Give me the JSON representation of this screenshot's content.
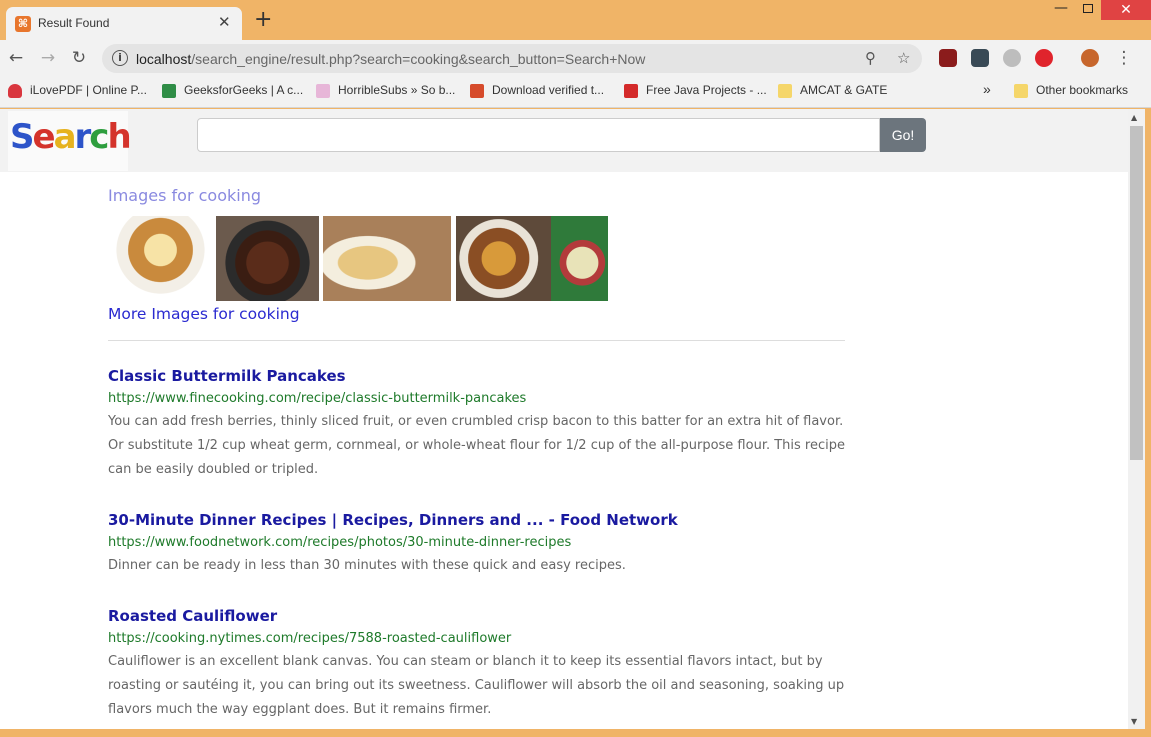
{
  "browser": {
    "tab_title": "Result Found",
    "favicon_glyph": "⌘",
    "close_glyph": "✕",
    "new_tab_glyph": "+",
    "url_host": "localhost",
    "url_path": "/search_engine/result.php?search=cooking&search_button=Search+Now",
    "bookmarks": [
      {
        "label": "iLovePDF | Online P...",
        "icon": "heart-icon",
        "color": "#d9363e"
      },
      {
        "label": "GeeksforGeeks | A c...",
        "icon": "gfg-icon",
        "color": "#2f8d46"
      },
      {
        "label": "HorribleSubs » So b...",
        "icon": "cat-icon",
        "color": "#e7b6d8"
      },
      {
        "label": "Download verified t...",
        "icon": "x-icon",
        "color": "#d64b2b"
      },
      {
        "label": "Free Java Projects - ...",
        "icon": "v-icon",
        "color": "#d42a2a"
      },
      {
        "label": "AMCAT & GATE",
        "icon": "folder-icon",
        "color": "#f5d66a"
      }
    ],
    "chevron": "»",
    "other_bookmarks": "Other bookmarks"
  },
  "search": {
    "logo_letters": [
      "S",
      "e",
      "a",
      "r",
      "c",
      "h"
    ],
    "query_value": "",
    "go_label": "Go!"
  },
  "images": {
    "heading": "Images for cooking",
    "more_link": "More Images for cooking"
  },
  "results": [
    {
      "title": "Classic Buttermilk Pancakes",
      "url": "https://www.finecooking.com/recipe/classic-buttermilk-pancakes",
      "description": "You can add fresh berries, thinly sliced fruit, or even crumbled crisp bacon to this batter for an extra hit of flavor. Or substitute 1/2 cup wheat germ, cornmeal, or whole-wheat flour for 1/2 cup of the all-purpose flour. This recipe can be easily doubled or tripled."
    },
    {
      "title": "30-Minute Dinner Recipes | Recipes, Dinners and ... - Food Network",
      "url": "https://www.foodnetwork.com/recipes/photos/30-minute-dinner-recipes",
      "description": "Dinner can be ready in less than 30 minutes with these quick and easy recipes."
    },
    {
      "title": "Roasted Cauliflower",
      "url": "https://cooking.nytimes.com/recipes/7588-roasted-cauliflower",
      "description": "Cauliflower is an excellent blank canvas. You can steam or blanch it to keep its essential flavors intact, but by roasting or sautéing it, you can bring out its sweetness. Cauliflower will absorb the oil and seasoning, soaking up flavors much the way eggplant does. But it remains firmer."
    }
  ],
  "colors": {
    "frame": "#f0b467",
    "title_link": "#1a1aa0",
    "url_green": "#1e7a2a",
    "go_button": "#6c757d"
  }
}
